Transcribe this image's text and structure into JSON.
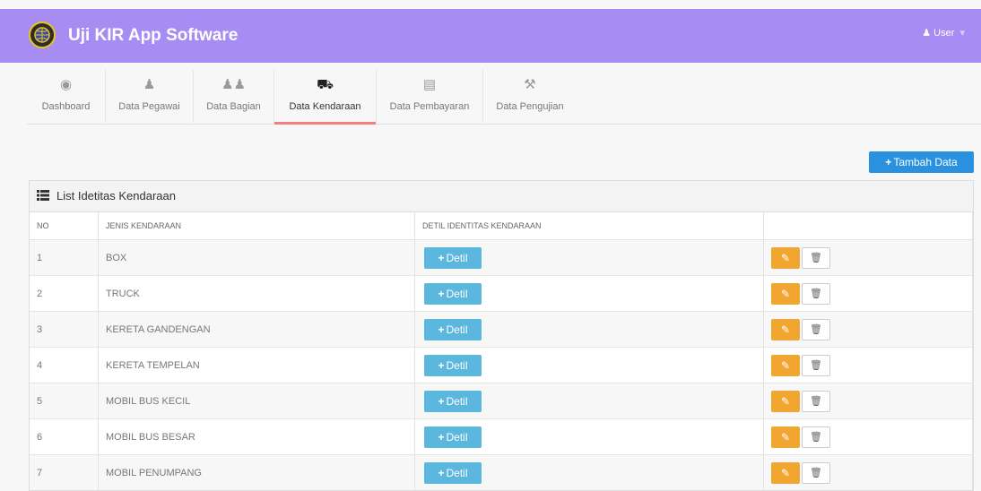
{
  "app": {
    "title": "Uji KIR App Software",
    "user_label": "User"
  },
  "nav": {
    "items": [
      {
        "label": "Dashboard",
        "icon": "dashboard-icon"
      },
      {
        "label": "Data Pegawai",
        "icon": "user-icon"
      },
      {
        "label": "Data Bagian",
        "icon": "users-icon"
      },
      {
        "label": "Data Kendaraan",
        "icon": "truck-icon"
      },
      {
        "label": "Data Pembayaran",
        "icon": "money-icon"
      },
      {
        "label": "Data Pengujian",
        "icon": "wrench-icon"
      }
    ],
    "active": "Data Kendaraan"
  },
  "actions": {
    "add_label": "Tambah Data"
  },
  "panel": {
    "title": "List Idetitas Kendaraan",
    "columns": [
      "NO",
      "JENIS KENDARAAN",
      "DETIL IDENTITAS KENDARAAN",
      ""
    ],
    "detail_label": "Detil",
    "rows": [
      {
        "no": "1",
        "jenis": "BOX"
      },
      {
        "no": "2",
        "jenis": "TRUCK"
      },
      {
        "no": "3",
        "jenis": "KERETA GANDENGAN"
      },
      {
        "no": "4",
        "jenis": "KERETA TEMPELAN"
      },
      {
        "no": "5",
        "jenis": "MOBIL BUS KECIL"
      },
      {
        "no": "6",
        "jenis": "MOBIL BUS BESAR"
      },
      {
        "no": "7",
        "jenis": "MOBIL PENUMPANG"
      }
    ]
  },
  "colors": {
    "topbar": "#a78cf3",
    "primary": "#2a90e0",
    "info": "#5bb7de",
    "warning": "#f2a632",
    "active_tab": "#f27e7e"
  }
}
